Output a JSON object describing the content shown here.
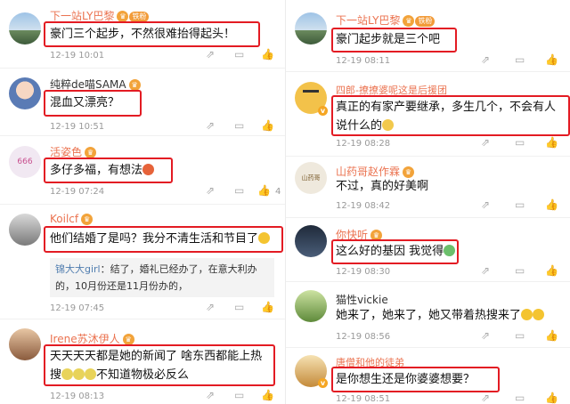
{
  "left": {
    "comments": [
      {
        "user": "下一站LY巴黎",
        "tag": "铁粉",
        "text": "豪门三个起步，不然很难抬得起头！",
        "meta": "12-19 10:01",
        "likes": ""
      },
      {
        "user": "纯粹de喵SAMA",
        "text": "混血又漂亮？",
        "meta": "12-19 10:51",
        "likes": ""
      },
      {
        "user": "活姿色",
        "text": "多仔多福，有想法",
        "meta": "12-19 07:24",
        "likes": "4"
      },
      {
        "user": "Koilcf",
        "text": "他们结婚了是吗？我分不清生活和节目了",
        "meta": "12-19 07:45",
        "likes": "",
        "reply": {
          "user": "锦大大girl",
          "text": "：结了，婚礼已经办了，在意大利办的，10月份还是11月份办的，"
        }
      },
      {
        "user": "Irene苏沐伊人",
        "text_line1": "天天天天都是她的新闻了 啥东西都能上热",
        "text_line2": "搜",
        "text_line2b": "不知道物极必反么",
        "meta": "12-19 08:13",
        "likes": ""
      }
    ]
  },
  "right": {
    "comments": [
      {
        "user": "下一站LY巴黎",
        "tag": "铁粉",
        "text": "豪门起步就是三个吧",
        "meta": "12-19 08:11",
        "likes": ""
      },
      {
        "user": "四郎-撩撩婆呢这是后援团",
        "text_line1": "真正的有家产要继承，多生几个，不会有人",
        "text_line2": "说什么的",
        "meta": "12-19 08:28",
        "likes": ""
      },
      {
        "user": "山药哥赵作霖",
        "text": "不过，真的好美啊",
        "meta": "12-19 08:42",
        "likes": ""
      },
      {
        "user": "你快听",
        "text": "这么好的基因 我觉得",
        "meta": "12-19 08:30",
        "likes": ""
      },
      {
        "user": "猫性vickie",
        "text": "她来了，她来了，她又带着热搜来了",
        "meta": "12-19 08:56",
        "likes": ""
      },
      {
        "user": "唐僧和他的徒弟",
        "text": "是你想生还是你婆婆想要？",
        "meta": "12-19 08:51",
        "likes": ""
      }
    ]
  },
  "icons": {
    "share": "share-icon",
    "comment": "comment-icon",
    "like": "thumb-up-icon"
  },
  "colors": {
    "username": "#eb7350",
    "highlight": "#e31b23",
    "reply_user": "#507daf"
  }
}
